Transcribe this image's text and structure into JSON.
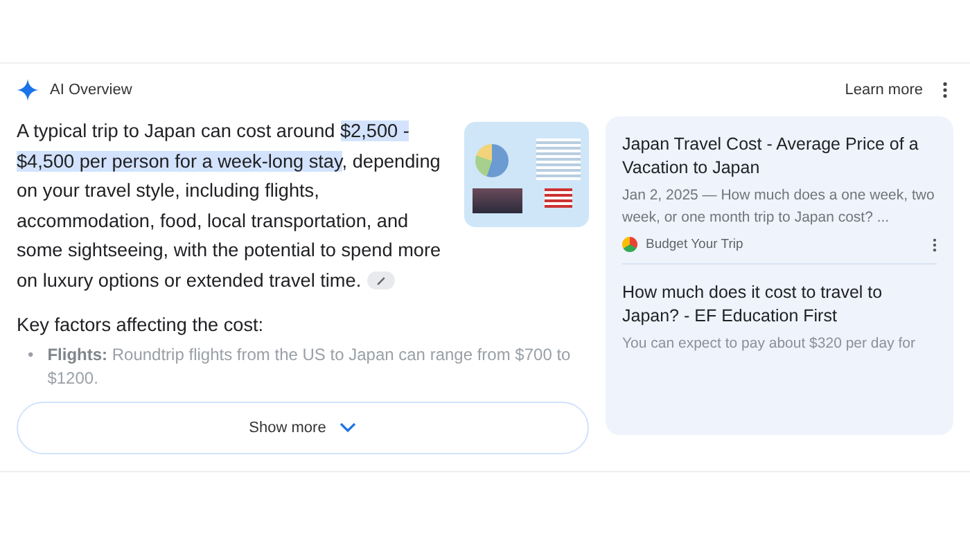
{
  "header": {
    "title": "AI Overview",
    "learn_more": "Learn more"
  },
  "summary": [
    {
      "text": "A typical trip to Japan can cost around ",
      "highlighted": false
    },
    {
      "text": "$2,500 - $4,500 per person for a week-long stay",
      "highlighted": true
    },
    {
      "text": ", depending on your travel style, including flights, accommodation, food, local transportation, and some sightseeing, with the potential to spend more on luxury options or extended travel time.",
      "highlighted": false
    }
  ],
  "key_factors": {
    "heading": "Key factors affecting the cost:",
    "items": [
      {
        "marker": "•",
        "label": "Flights:",
        "text": "Roundtrip flights from the US to Japan can range from $700 to $1200."
      }
    ]
  },
  "show_more": "Show more",
  "sources": [
    {
      "title": "Japan Travel Cost - Average Price of a Vacation to Japan",
      "snippet": "Jan 2, 2025 — How much does a one week, two week, or one month trip to Japan cost? ...",
      "site": "Budget Your Trip"
    },
    {
      "title": "How much does it cost to travel to Japan? - EF Education First",
      "snippet": "You can expect to pay about $320 per day for"
    }
  ]
}
